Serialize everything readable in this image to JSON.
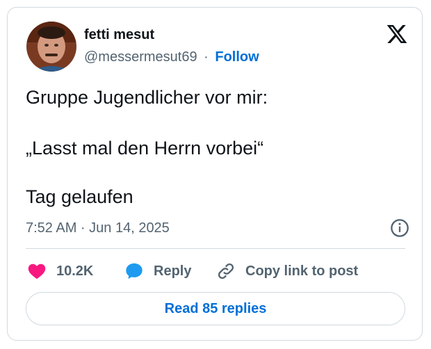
{
  "author": {
    "name": "fetti mesut",
    "handle": "@messermesut69",
    "separator": "·",
    "follow_label": "Follow"
  },
  "tweet": {
    "lines": [
      "Gruppe Jugendlicher vor mir:",
      "„Lasst mal den Herrn vorbei“",
      "Tag gelaufen"
    ],
    "timestamp": "7:52 AM · Jun 14, 2025"
  },
  "actions": {
    "likes": "10.2K",
    "reply_label": "Reply",
    "copy_link_label": "Copy link to post"
  },
  "read_replies_label": "Read 85 replies",
  "icons": {
    "brand": "x-logo-icon",
    "info": "info-icon",
    "like": "heart-icon",
    "reply": "speech-bubble-icon",
    "link": "link-icon"
  },
  "colors": {
    "link_blue": "#006fd6",
    "like_pink": "#f91880",
    "reply_blue": "#1d9bf0",
    "muted": "#536471",
    "border": "#cfd9de"
  }
}
